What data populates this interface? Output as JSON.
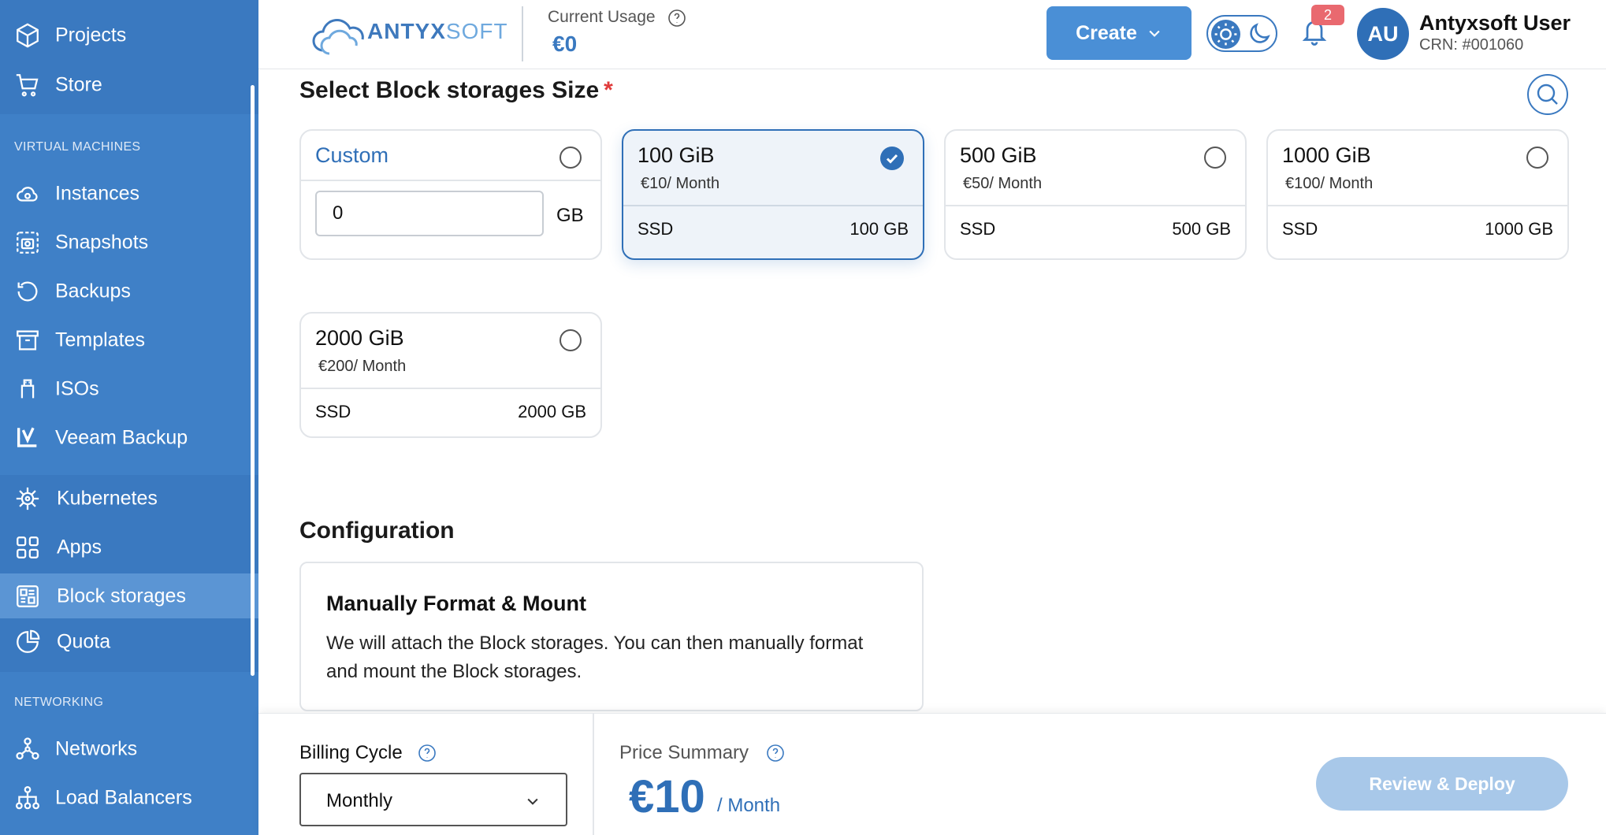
{
  "sidebar": {
    "top_items": [
      {
        "label": "Projects",
        "icon": "cube-icon"
      },
      {
        "label": "Store",
        "icon": "cart-icon"
      }
    ],
    "vm_section": "VIRTUAL MACHINES",
    "vm_items": [
      {
        "label": "Instances",
        "icon": "cloud-icon"
      },
      {
        "label": "Snapshots",
        "icon": "camera-icon"
      },
      {
        "label": "Backups",
        "icon": "history-icon"
      },
      {
        "label": "Templates",
        "icon": "archive-icon"
      },
      {
        "label": "ISOs",
        "icon": "usb-icon"
      },
      {
        "label": "Veeam Backup",
        "icon": "veeam-icon"
      }
    ],
    "mid_items": [
      {
        "label": "Kubernetes",
        "icon": "helm-icon"
      },
      {
        "label": "Apps",
        "icon": "apps-grid-icon"
      },
      {
        "label": "Block storages",
        "icon": "block-storage-icon",
        "active": true
      },
      {
        "label": "Quota",
        "icon": "pie-chart-icon"
      }
    ],
    "net_section": "NETWORKING",
    "net_items": [
      {
        "label": "Networks",
        "icon": "network-icon"
      },
      {
        "label": "Load Balancers",
        "icon": "load-balancer-icon"
      }
    ]
  },
  "header": {
    "logo_main": "ANTYX",
    "logo_soft": "SOFT",
    "usage_label": "Current Usage",
    "usage_value": "€0",
    "create_label": "Create",
    "notification_count": "2",
    "avatar_initials": "AU",
    "user_name": "Antyxsoft User",
    "user_crn": "CRN: #001060"
  },
  "size_section": {
    "title": "Select Block storages Size",
    "required_mark": "*",
    "custom": {
      "label": "Custom",
      "value": "0",
      "unit": "GB"
    },
    "options": [
      {
        "name": "100 GiB",
        "price": "€10/ Month",
        "type": "SSD",
        "size": "100 GB",
        "selected": true
      },
      {
        "name": "500 GiB",
        "price": "€50/ Month",
        "type": "SSD",
        "size": "500 GB",
        "selected": false
      },
      {
        "name": "1000 GiB",
        "price": "€100/ Month",
        "type": "SSD",
        "size": "1000 GB",
        "selected": false
      },
      {
        "name": "2000 GiB",
        "price": "€200/ Month",
        "type": "SSD",
        "size": "2000 GB",
        "selected": false
      }
    ]
  },
  "configuration": {
    "title": "Configuration",
    "option_title": "Manually Format & Mount",
    "option_desc": "We will attach the Block storages. You can then manually format and mount the Block storages."
  },
  "footer": {
    "billing_label": "Billing Cycle",
    "billing_value": "Monthly",
    "price_label": "Price Summary",
    "price_value": "€10",
    "price_unit": "/ Month",
    "deploy_label": "Review & Deploy"
  },
  "colors": {
    "sidebar": "#3a79c0",
    "sidebar_active": "#5b95d4",
    "accent": "#2f6fb7",
    "badge": "#e9696f",
    "deploy_disabled": "#a8c8e9"
  }
}
